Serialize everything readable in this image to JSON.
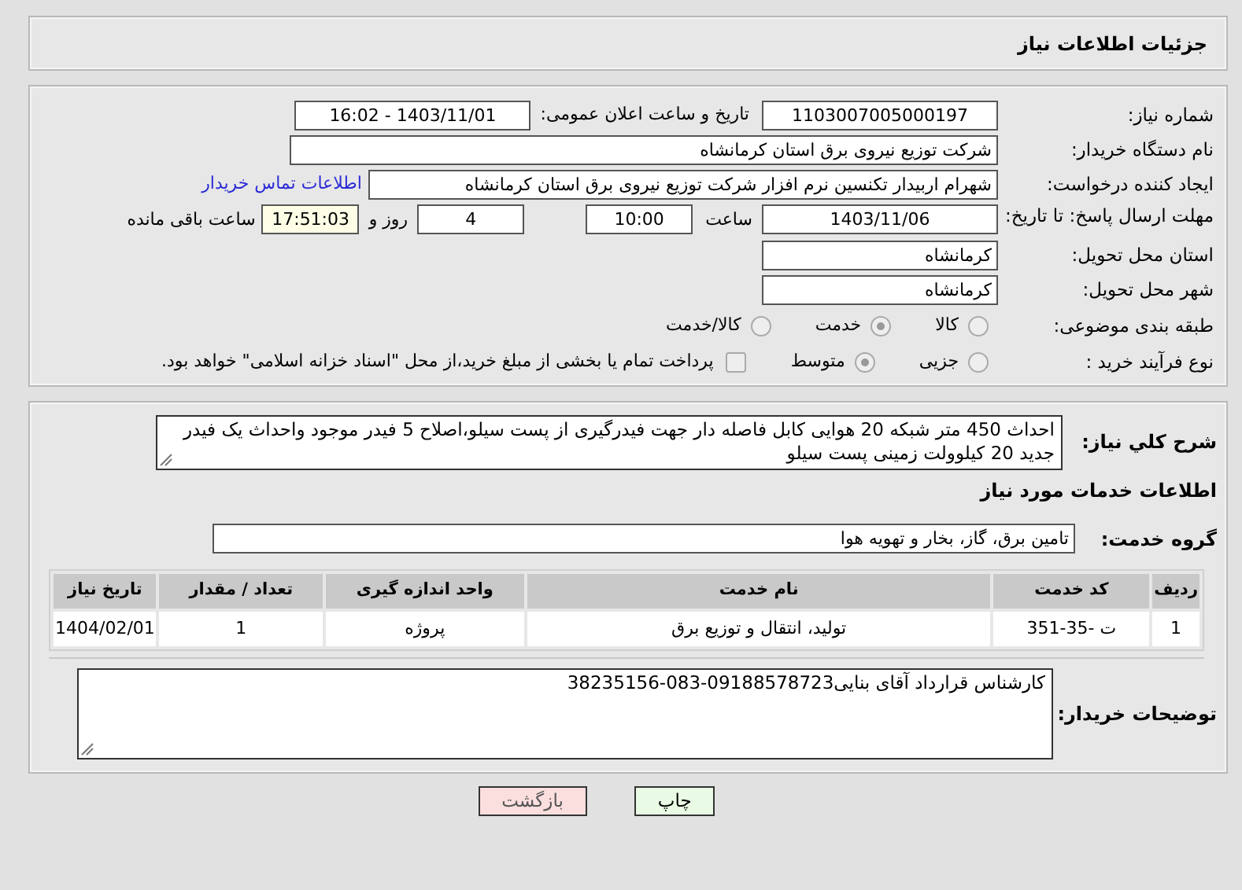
{
  "header": {
    "title": "جزئیات اطلاعات نیاز"
  },
  "need_number": {
    "label": "شماره نیاز:",
    "value": "1103007005000197"
  },
  "announce": {
    "label": "تاریخ و ساعت اعلان عمومی:",
    "value": "1403/11/01 - 16:02"
  },
  "buyer": {
    "label": "نام دستگاه خریدار:",
    "value": "شرکت توزیع نیروی برق استان کرمانشاه"
  },
  "requester": {
    "label": "ایجاد کننده درخواست:",
    "value": "شهرام اربیدار تکنسین نرم افزار شرکت توزیع نیروی برق استان کرمانشاه",
    "link": "اطلاعات تماس خریدار"
  },
  "deadline": {
    "label": "مهلت ارسال پاسخ: تا تاریخ:",
    "date": "1403/11/06",
    "time_label": "ساعت",
    "time": "10:00",
    "days": "4",
    "days_label": "روز و",
    "remaining": "17:51:03",
    "remaining_label": "ساعت باقی مانده"
  },
  "province": {
    "label": "استان محل تحویل:",
    "value": "کرمانشاه"
  },
  "city": {
    "label": "شهر محل تحویل:",
    "value": "کرمانشاه"
  },
  "category": {
    "label": "طبقه بندی موضوعی:",
    "options": [
      {
        "label": "کالا",
        "selected": false
      },
      {
        "label": "خدمت",
        "selected": true
      },
      {
        "label": "کالا/خدمت",
        "selected": false
      }
    ]
  },
  "process": {
    "label": "نوع فرآیند خرید :",
    "options": [
      {
        "label": "جزیی",
        "selected": false
      },
      {
        "label": "متوسط",
        "selected": true
      }
    ],
    "payment": {
      "checked": false,
      "text": "پرداخت تمام یا بخشی از مبلغ خرید،از محل \"اسناد خزانه اسلامی\" خواهد بود."
    }
  },
  "summary": {
    "label": "شرح کلي نياز:",
    "value": "احداث 450 متر شبکه 20 هوایی کابل فاصله دار جهت فیدرگیری از پست سیلو،اصلاح 5 فیدر موجود واحداث یک فیدر جدید 20 کیلوولت زمینی پست سیلو"
  },
  "services": {
    "title": "اطلاعات خدمات مورد نیاز",
    "group_label": "گروه خدمت:",
    "group": "تامین برق، گاز، بخار و تهویه هوا",
    "table": {
      "columns": [
        "ردیف",
        "کد خدمت",
        "نام خدمت",
        "واحد اندازه گیری",
        "تعداد / مقدار",
        "تاریخ نیاز"
      ],
      "rows": [
        [
          "1",
          "ت -35-351",
          "تولید، انتقال و توزیع برق",
          "پروژه",
          "1",
          "1404/02/01"
        ]
      ]
    }
  },
  "buyer_notes": {
    "label": "توضیحات خریدار:",
    "value": "کارشناس قرارداد آقای بنایی09188578723-083-38235156"
  },
  "buttons": [
    {
      "label": "چاپ",
      "kind": "print"
    },
    {
      "label": "بازگشت",
      "kind": "back"
    }
  ]
}
